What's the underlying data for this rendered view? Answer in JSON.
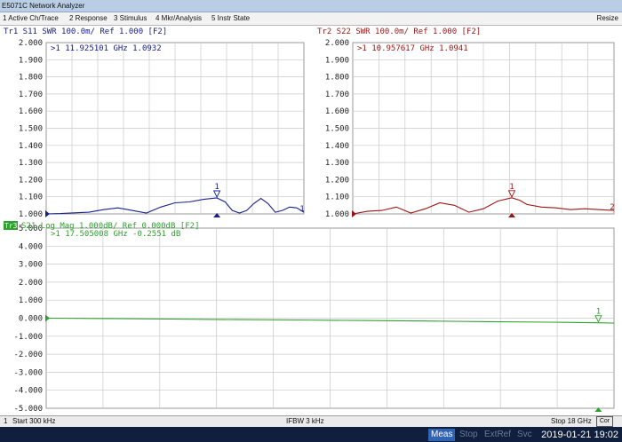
{
  "window": {
    "title": "E5071C Network Analyzer"
  },
  "menu": [
    {
      "label": "1 Active Ch/Trace"
    },
    {
      "label": "2 Response"
    },
    {
      "label": "3 Stimulus"
    },
    {
      "label": "4 Mkr/Analysis"
    },
    {
      "label": "5 Instr State"
    }
  ],
  "resize_label": "Resize",
  "colors": {
    "tr1": "#16218f",
    "tr2": "#9c1414",
    "tr3": "#2ea02e",
    "grid": "#c8c8c8",
    "axis_text": "#222222"
  },
  "chart_data": [
    {
      "type": "line",
      "header": "Tr1 S11 SWR 100.0m/ Ref 1.000 [F2]",
      "marker_readout": ">1  11.925101 GHz  1.0932",
      "marker_label": "1",
      "end_marker_label": "1",
      "yticks": [
        "2.000",
        "1.900",
        "1.800",
        "1.700",
        "1.600",
        "1.500",
        "1.400",
        "1.300",
        "1.200",
        "1.100",
        "1.000"
      ],
      "ylim": [
        1.0,
        2.0
      ],
      "x_ghz": [
        0.0003,
        1,
        2,
        3,
        4,
        5,
        6,
        7,
        8,
        9,
        10,
        11,
        11.925,
        12.5,
        13,
        13.5,
        14,
        14.5,
        15,
        15.5,
        16,
        16.5,
        17,
        17.5,
        18
      ],
      "y": [
        1.0,
        1.002,
        1.006,
        1.01,
        1.025,
        1.035,
        1.02,
        1.005,
        1.04,
        1.065,
        1.07,
        1.085,
        1.0932,
        1.07,
        1.02,
        1.005,
        1.02,
        1.06,
        1.09,
        1.06,
        1.01,
        1.02,
        1.04,
        1.035,
        1.01
      ],
      "marker_x": 11.925,
      "marker_y": 1.0932
    },
    {
      "type": "line",
      "header": "Tr2 S22 SWR 100.0m/ Ref 1.000 [F2]",
      "marker_readout": ">1  10.957617 GHz  1.0941",
      "marker_label": "1",
      "end_marker_label": "2",
      "yticks": [
        "2.000",
        "1.900",
        "1.800",
        "1.700",
        "1.600",
        "1.500",
        "1.400",
        "1.300",
        "1.200",
        "1.100",
        "1.000"
      ],
      "ylim": [
        1.0,
        2.0
      ],
      "x_ghz": [
        0.0003,
        1,
        2,
        3,
        4,
        5,
        6,
        7,
        8,
        9,
        10,
        10.958,
        11.5,
        12,
        13,
        14,
        15,
        16,
        17,
        18
      ],
      "y": [
        1.0,
        1.015,
        1.02,
        1.04,
        1.005,
        1.03,
        1.065,
        1.05,
        1.01,
        1.03,
        1.075,
        1.0941,
        1.08,
        1.055,
        1.04,
        1.035,
        1.025,
        1.03,
        1.025,
        1.02
      ],
      "marker_x": 10.958,
      "marker_y": 1.0941
    },
    {
      "type": "line",
      "badge": "Tr3",
      "header": "S21 Log Mag 1.000dB/ Ref 0.000dB [F2]",
      "marker_readout": ">1  17.505008 GHz -0.2551 dB",
      "marker_label": "1",
      "yticks": [
        "5.000",
        "4.000",
        "3.000",
        "2.000",
        "1.000",
        "0.000",
        "-1.000",
        "-2.000",
        "-3.000",
        "-4.000",
        "-5.000"
      ],
      "ylim": [
        -5.0,
        5.0
      ],
      "x_ghz": [
        0.0003,
        2,
        4,
        6,
        8,
        10,
        12,
        14,
        16,
        17.505,
        18
      ],
      "y": [
        0.0,
        -0.02,
        -0.05,
        -0.08,
        -0.1,
        -0.13,
        -0.16,
        -0.19,
        -0.22,
        -0.2551,
        -0.27
      ],
      "marker_x": 17.505,
      "marker_y": -0.2551
    }
  ],
  "status": {
    "channel": "1",
    "start": "Start 300 kHz",
    "ifbw": "IFBW 3 kHz",
    "stop": "Stop 18 GHz",
    "cor": "Cor"
  },
  "taskbar": {
    "items": [
      "Meas",
      "Stop",
      "ExtRef",
      "Svc"
    ],
    "datetime": "2019-01-21 19:02"
  }
}
